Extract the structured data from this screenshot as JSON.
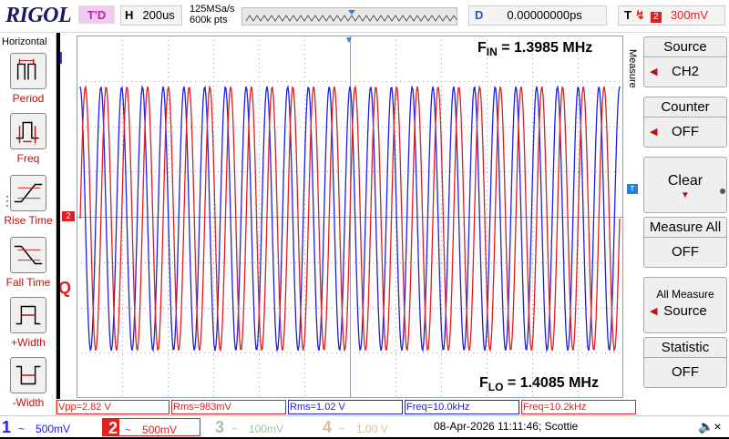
{
  "topbar": {
    "logo": "RIGOL",
    "status": "T'D",
    "horizontal_key": "H",
    "timebase": "200us",
    "sample_rate": "125MSa/s",
    "mem_depth": "600k pts",
    "delay_key": "D",
    "delay": "0.00000000ps",
    "trigger_key": "T",
    "trigger_channel": "2",
    "trigger_level": "300mV"
  },
  "left_panel": {
    "title": "Horizontal",
    "items": [
      {
        "label": "Period",
        "icon": "period-icon"
      },
      {
        "label": "Freq",
        "icon": "freq-icon"
      },
      {
        "label": "Rise Time",
        "icon": "rise-time-icon"
      },
      {
        "label": "Fall Time",
        "icon": "fall-time-icon"
      },
      {
        "label": "+Width",
        "icon": "pos-width-icon"
      },
      {
        "label": "-Width",
        "icon": "neg-width-icon"
      }
    ]
  },
  "screen": {
    "marker_i": "I",
    "marker_q": "Q",
    "ch2_marker": "2",
    "trig_marker": "T",
    "f_in_main": "F",
    "f_in_sub": "IN",
    "f_in_value": " = 1.3985 MHz",
    "f_lo_main": "F",
    "f_lo_sub": "LO",
    "f_lo_value": " = 1.4085 MHz",
    "ch1_color": "#2020e0",
    "ch2_color": "#e02020",
    "cycles": 26
  },
  "measurements": [
    {
      "text": "Vpp=2.82 V",
      "color": "#e02020"
    },
    {
      "text": "Rms=983mV",
      "color": "#e02020"
    },
    {
      "text": "Rms=1.02 V",
      "color": "#2020e0"
    },
    {
      "text": "Freq=10.0kHz",
      "color": "#2020e0"
    },
    {
      "text": "Freq=10.2kHz",
      "color": "#e02020"
    }
  ],
  "right_panel": {
    "title": "Measure",
    "buttons": [
      {
        "label": "Source",
        "value": "CH2"
      },
      {
        "label": "Counter",
        "value": "OFF"
      },
      {
        "label": "Clear",
        "value": ""
      },
      {
        "label": "Measure All",
        "value": "OFF"
      },
      {
        "label": "All Measure",
        "value": "Source"
      },
      {
        "label": "Statistic",
        "value": "OFF"
      }
    ]
  },
  "channels": [
    {
      "num": "1",
      "scale": "500mV",
      "color": "#2020e0"
    },
    {
      "num": "2",
      "scale": "500mV",
      "color": "#e02020"
    },
    {
      "num": "3",
      "scale": "100mV",
      "color": "#a0c8a0"
    },
    {
      "num": "4",
      "scale": "1.00 V",
      "color": "#d8c0a0"
    }
  ],
  "status_line": "08-Apr-2026 11:11:46; Scottie"
}
